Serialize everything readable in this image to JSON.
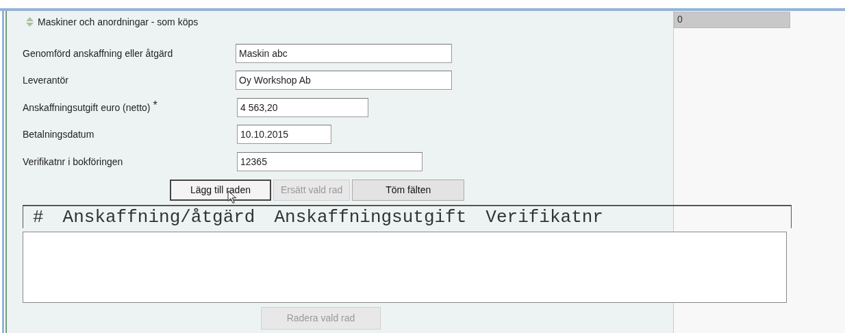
{
  "section": {
    "title": "Maskiner och anordningar - som köps"
  },
  "fields": [
    {
      "label": "Genomförd anskaffning eller åtgärd",
      "value": "Maskin abc"
    },
    {
      "label": "Leverantör",
      "value": "Oy Workshop Ab"
    },
    {
      "label": "Anskaffningsutgift euro (netto)",
      "value": "4 563,20",
      "required_mark": "*"
    },
    {
      "label": "Betalningsdatum",
      "value": "10.10.2015"
    },
    {
      "label": "Verifikatnr i bokföringen",
      "value": "12365"
    }
  ],
  "buttons": [
    {
      "label": "Lägg till raden",
      "disabled": false
    },
    {
      "label": "Ersätt vald rad",
      "disabled": true
    },
    {
      "label": "Töm fälten",
      "disabled": false
    }
  ],
  "table": {
    "columns": [
      "#",
      "Anskaffning/åtgärd",
      "Anskaffningsutgift",
      "Verifikatnr"
    ]
  },
  "delete_button": {
    "label": "Radera vald rad",
    "disabled": true
  },
  "side_field": {
    "value": "0"
  }
}
